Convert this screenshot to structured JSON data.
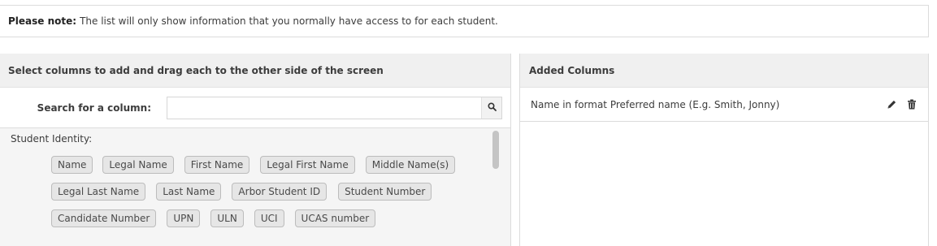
{
  "note": {
    "label": "Please note:",
    "text": "The list will only show information that you normally have access to for each student."
  },
  "left_panel": {
    "header": "Select columns to add and drag each to the other side of the screen",
    "search_label": "Search for a column:",
    "search_value": "",
    "search_icon": "search-icon",
    "group_title": "Student Identity:",
    "chip_rows": [
      [
        "Name",
        "Legal Name",
        "First Name",
        "Legal First Name",
        "Middle Name(s)"
      ],
      [
        "Legal Last Name",
        "Last Name",
        "Arbor Student ID",
        "Student Number"
      ],
      [
        "Candidate Number",
        "UPN",
        "ULN",
        "UCI",
        "UCAS number"
      ]
    ]
  },
  "right_panel": {
    "header": "Added Columns",
    "items": [
      {
        "label": "Name in format Preferred name (E.g. Smith, Jonny)",
        "edit_icon": "pencil-icon",
        "delete_icon": "trash-icon"
      }
    ]
  },
  "colors": {
    "header_bg": "#f0f0f0",
    "list_bg": "#f5f5f5",
    "chip_bg": "#e6e6e6",
    "chip_border": "#bcbcbc",
    "border": "#dcdcdc"
  }
}
